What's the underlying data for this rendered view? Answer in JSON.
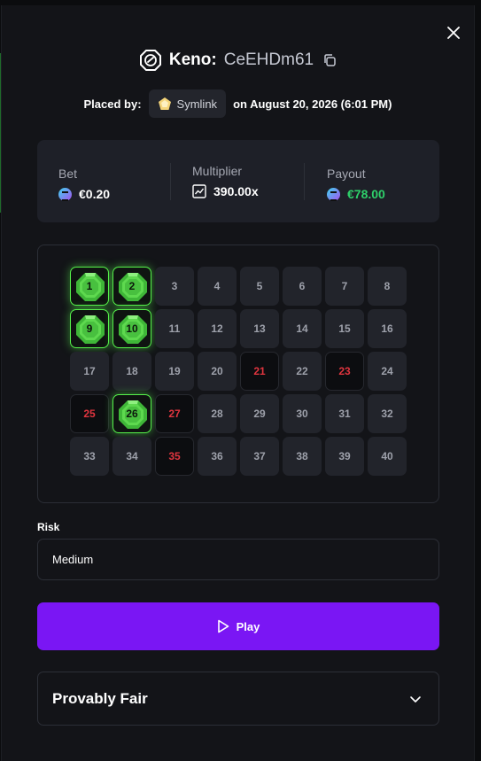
{
  "header": {
    "game_title": "Keno:",
    "bet_id": "CeEHDm61",
    "icons": {
      "game": "keno-icon",
      "copy": "copy-icon",
      "close": "close-icon"
    }
  },
  "placed": {
    "prefix": "Placed by:",
    "username": "Symlink",
    "date_text": "on August 20, 2026 (6:01 PM)"
  },
  "stats": {
    "bet_label": "Bet",
    "bet_value": "€0.20",
    "multiplier_label": "Multiplier",
    "multiplier_value": "390.00x",
    "payout_label": "Payout",
    "payout_value": "€78.00",
    "payout_color": "#2ed06a"
  },
  "board": {
    "tiles": [
      {
        "n": "1",
        "state": "hit"
      },
      {
        "n": "2",
        "state": "hit"
      },
      {
        "n": "3",
        "state": "none"
      },
      {
        "n": "4",
        "state": "none"
      },
      {
        "n": "5",
        "state": "none"
      },
      {
        "n": "6",
        "state": "none"
      },
      {
        "n": "7",
        "state": "none"
      },
      {
        "n": "8",
        "state": "none"
      },
      {
        "n": "9",
        "state": "hit"
      },
      {
        "n": "10",
        "state": "hit"
      },
      {
        "n": "11",
        "state": "none"
      },
      {
        "n": "12",
        "state": "none"
      },
      {
        "n": "13",
        "state": "none"
      },
      {
        "n": "14",
        "state": "none"
      },
      {
        "n": "15",
        "state": "none"
      },
      {
        "n": "16",
        "state": "none"
      },
      {
        "n": "17",
        "state": "none"
      },
      {
        "n": "18",
        "state": "none"
      },
      {
        "n": "19",
        "state": "none"
      },
      {
        "n": "20",
        "state": "none"
      },
      {
        "n": "21",
        "state": "miss"
      },
      {
        "n": "22",
        "state": "none"
      },
      {
        "n": "23",
        "state": "miss"
      },
      {
        "n": "24",
        "state": "none"
      },
      {
        "n": "25",
        "state": "miss"
      },
      {
        "n": "26",
        "state": "hit"
      },
      {
        "n": "27",
        "state": "miss"
      },
      {
        "n": "28",
        "state": "none"
      },
      {
        "n": "29",
        "state": "none"
      },
      {
        "n": "30",
        "state": "none"
      },
      {
        "n": "31",
        "state": "none"
      },
      {
        "n": "32",
        "state": "none"
      },
      {
        "n": "33",
        "state": "none"
      },
      {
        "n": "34",
        "state": "none"
      },
      {
        "n": "35",
        "state": "miss"
      },
      {
        "n": "36",
        "state": "none"
      },
      {
        "n": "37",
        "state": "none"
      },
      {
        "n": "38",
        "state": "none"
      },
      {
        "n": "39",
        "state": "none"
      },
      {
        "n": "40",
        "state": "none"
      }
    ],
    "colors": {
      "hit": "#55f04a",
      "miss_text": "#e0353f",
      "tile": "#22242b"
    }
  },
  "risk": {
    "label": "Risk",
    "value": "Medium"
  },
  "play": {
    "label": "Play",
    "color": "#7a16f4"
  },
  "fair": {
    "title": "Provably Fair"
  }
}
